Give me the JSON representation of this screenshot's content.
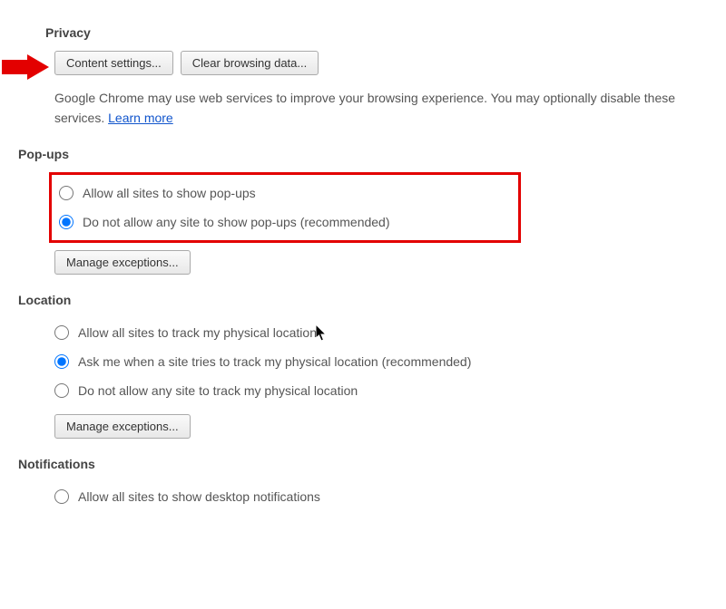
{
  "privacy": {
    "title": "Privacy",
    "content_settings_label": "Content settings...",
    "clear_browsing_label": "Clear browsing data...",
    "description_part1": "Google Chrome may use web services to improve your browsing experience. You may optionally disable these services. ",
    "learn_more_label": "Learn more"
  },
  "popups": {
    "title": "Pop-ups",
    "options": [
      {
        "label": "Allow all sites to show pop-ups",
        "checked": false
      },
      {
        "label": "Do not allow any site to show pop-ups (recommended)",
        "checked": true
      }
    ],
    "manage_label": "Manage exceptions..."
  },
  "location": {
    "title": "Location",
    "options": [
      {
        "label": "Allow all sites to track my physical location",
        "checked": false
      },
      {
        "label": "Ask me when a site tries to track my physical location (recommended)",
        "checked": true
      },
      {
        "label": "Do not allow any site to track my physical location",
        "checked": false
      }
    ],
    "manage_label": "Manage exceptions..."
  },
  "notifications": {
    "title": "Notifications",
    "options": [
      {
        "label": "Allow all sites to show desktop notifications",
        "checked": false
      }
    ]
  }
}
